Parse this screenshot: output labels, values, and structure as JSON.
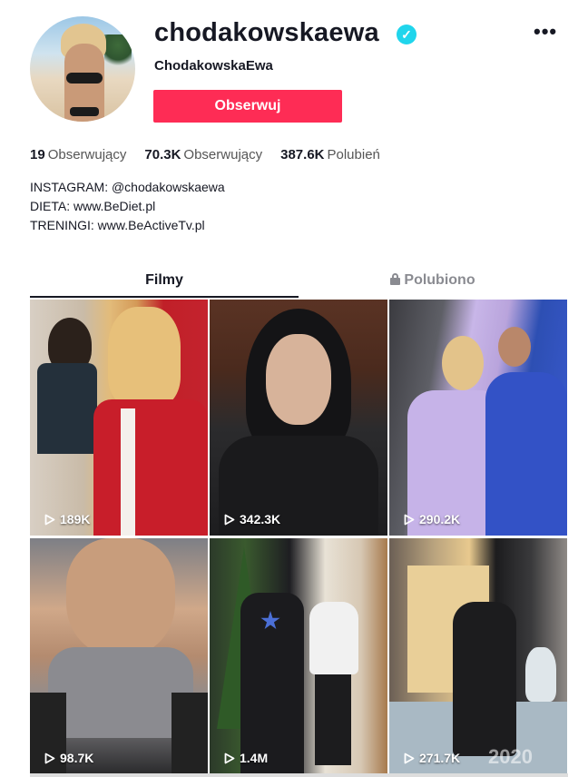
{
  "profile": {
    "username": "chodakowskaewa",
    "nickname": "ChodakowskaEwa",
    "follow_label": "Obserwuj",
    "more_label": "•••",
    "verified_mark": "✓"
  },
  "stats": [
    {
      "value": "19",
      "label": "Obserwujący"
    },
    {
      "value": "70.3K",
      "label": "Obserwujący"
    },
    {
      "value": "387.6K",
      "label": "Polubień"
    }
  ],
  "bio": [
    "INSTAGRAM: @chodakowskaewa",
    "DIETA: www.BeDiet.pl",
    "TRENINGI: www.BeActiveTv.pl"
  ],
  "tabs": {
    "videos": "Filmy",
    "liked": "Polubiono"
  },
  "videos": [
    {
      "views": "189K"
    },
    {
      "views": "342.3K"
    },
    {
      "views": "290.2K"
    },
    {
      "views": "98.7K"
    },
    {
      "views": "1.4M"
    },
    {
      "views": "271.7K",
      "overlay_text": "2020"
    }
  ],
  "colors": {
    "accent": "#fe2c55",
    "verified": "#20d5ec",
    "text": "#161823"
  },
  "icons": {
    "verified": "verified-badge-icon",
    "more": "more-options-icon",
    "lock": "lock-icon",
    "play": "play-icon"
  }
}
